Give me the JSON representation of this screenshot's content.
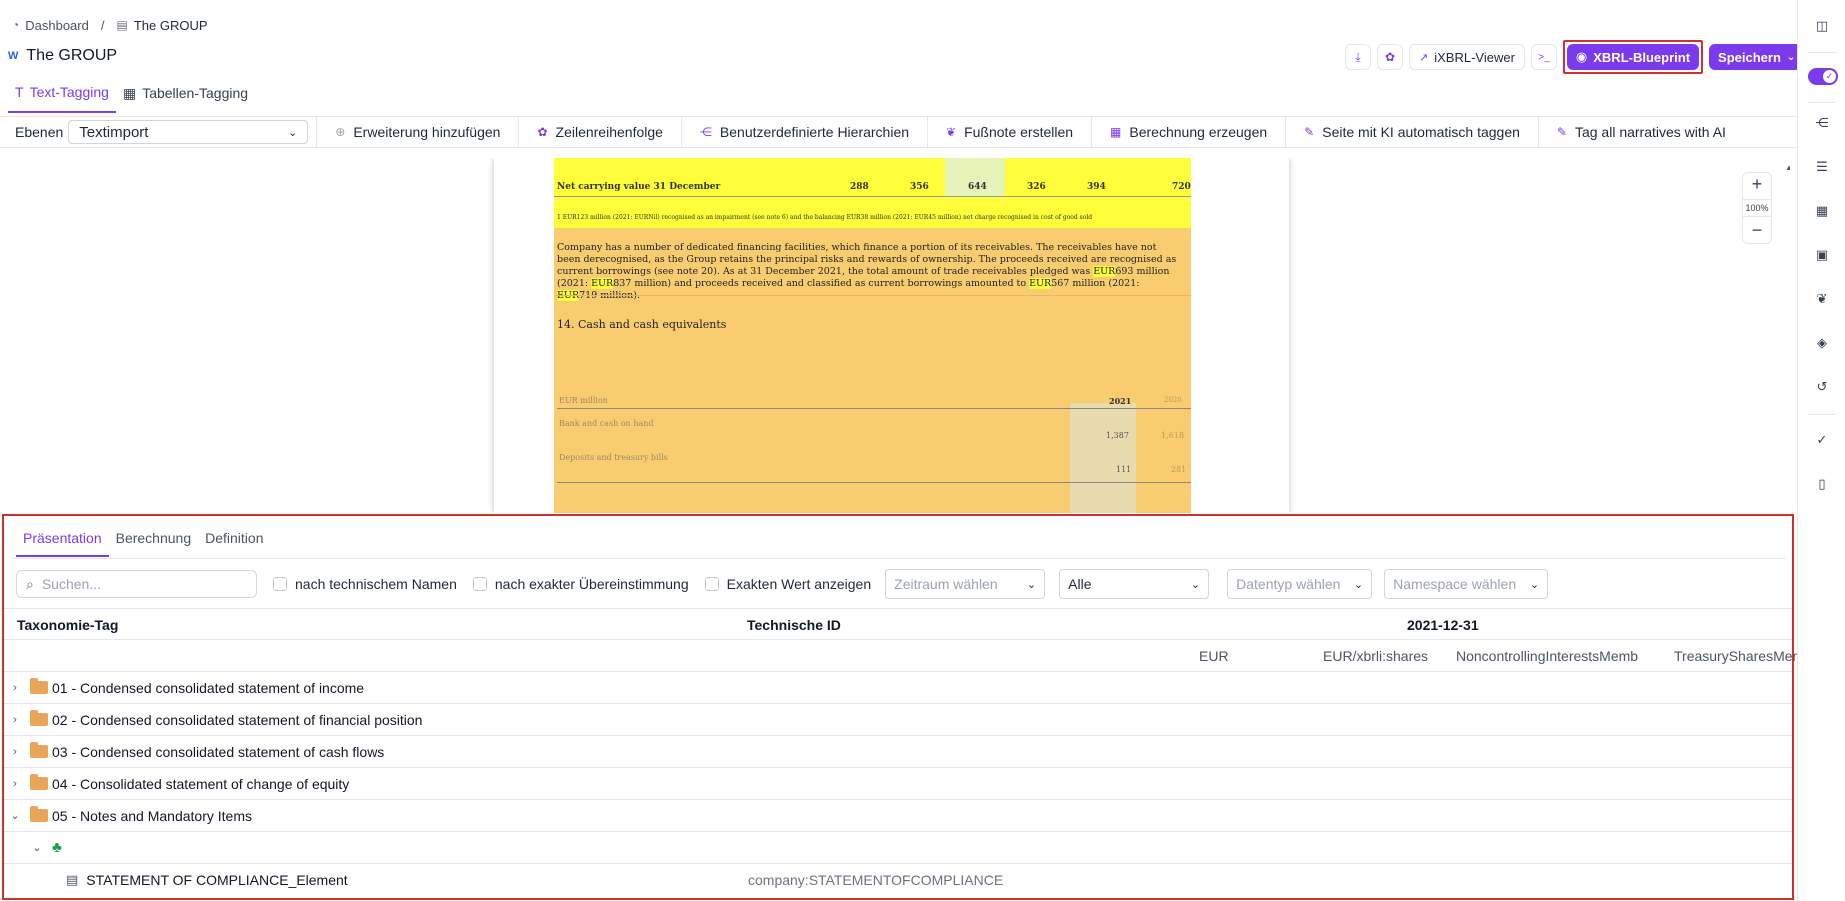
{
  "breadcrumb": {
    "home": "Dashboard",
    "sep": "/",
    "current": "The GROUP"
  },
  "page": {
    "title": "The GROUP",
    "doc_icon": "W"
  },
  "actions": {
    "ixbrl_viewer": "iXBRL-Viewer",
    "terminal": ">_",
    "xbrl_blueprint": "XBRL-Blueprint",
    "save": "Speichern"
  },
  "top_tabs": [
    {
      "label": "Text-Tagging",
      "active": true
    },
    {
      "label": "Tabellen-Tagging",
      "active": false
    }
  ],
  "toolbar": {
    "ebenen_label": "Ebenen",
    "ebenen_value": "Textimport",
    "items": [
      "Erweiterung hinzufügen",
      "Zeilenreihenfolge",
      "Benutzerdefinierte Hierarchien",
      "Fußnote erstellen",
      "Berechnung erzeugen",
      "Seite mit KI automatisch taggen",
      "Tag all narratives with AI"
    ]
  },
  "document": {
    "ncv_label": "Net carrying value 31 December",
    "ncv_values": [
      "288",
      "356",
      "644",
      "326",
      "394",
      "720"
    ],
    "footnote": "1    EUR123 million (2021: EURNil) recognised as an impairment (see note 6) and the balancing EUR38 million (2021: EUR45 million) net charge recognised in cost of good sold",
    "para_1": "Company has a number of dedicated financing facilities, which finance a portion of its receivables. The receivables have not been derecognised, as the Group retains the principal risks and rewards of ownership. The proceeds received are recognised as current borrowings (see note 20). As at 31 December 2021, the total amount of trade receivables pledged was ",
    "hl_1": "EUR",
    "para_2": "693 million (2021: ",
    "hl_2": "EUR",
    "para_3": "837 million) and proceeds received and classified as current borrowings amounted to ",
    "hl_3": "EUR",
    "para_4": "567 million (2021: ",
    "hl_4": "EUR",
    "para_5": "719 million).",
    "cash_heading": "14. Cash and cash equivalents",
    "eur_million": "EUR million",
    "year_2021": "2021",
    "year_2020": "2020",
    "bank_label": "Bank and cash on hand",
    "bank_2021": "1,387",
    "bank_2020": "1,618",
    "deposits_label": "Deposits and treasury bills",
    "deposits_2021": "111",
    "deposits_2020": "281",
    "zoom_level": "100%"
  },
  "panel": {
    "tabs": [
      {
        "label": "Präsentation",
        "active": true
      },
      {
        "label": "Berechnung",
        "active": false
      },
      {
        "label": "Definition",
        "active": false
      }
    ],
    "search_placeholder": "Suchen...",
    "checkbox_1": "nach technischem Namen",
    "checkbox_2": "nach exakter Übereinstimmung",
    "checkbox_3": "Exakten Wert anzeigen",
    "period_placeholder": "Zeitraum wählen",
    "filter_all": "Alle",
    "datatype_placeholder": "Datentyp wählen",
    "namespace_placeholder": "Namespace wählen",
    "col_tag": "Taxonomie-Tag",
    "col_techid": "Technische ID",
    "col_date": "2021-12-31",
    "sub_cols": [
      "EUR",
      "EUR/xbrli:shares",
      "NoncontrollingInterestsMemb",
      "TreasurySharesMember"
    ],
    "rows": [
      "01 - Condensed consolidated statement of income",
      "02 - Condensed consolidated statement of financial position",
      "03 - Condensed consolidated statement of cash flows",
      "04 - Consolidated statement of change of equity",
      "05 - Notes and Mandatory Items"
    ],
    "leaf_name": "STATEMENT OF COMPLIANCE_Element",
    "leaf_techid": "company:STATEMENTOFCOMPLIANCE"
  }
}
